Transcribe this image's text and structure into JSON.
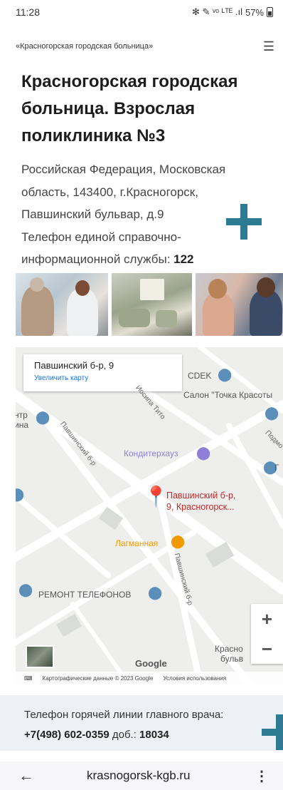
{
  "status_bar": {
    "time": "11:28",
    "icons": "✻ ✎ ᵛᵒ ᴸᵀᴱ .ıl",
    "battery": "57%"
  },
  "header": {
    "breadcrumb": "«Красногорская городская больница»",
    "menu_icon": "hamburger-icon"
  },
  "page": {
    "title": "Красногорская городская больница. Взрослая поликлиника №3",
    "address_lines": [
      "Российская Федерация, Московская",
      "область, 143400, г.Красногорск,",
      "Павшинский бульвар, д.9",
      "Телефон единой справочно-"
    ],
    "phone_label": "информационной службы: ",
    "phone_value": "122"
  },
  "photos": [
    "photo-1",
    "photo-2",
    "photo-3"
  ],
  "map": {
    "info_title": "Павшинский б-р, 9",
    "info_link": "Увеличить карту",
    "marker_label_1": "Павшинский б-р,",
    "marker_label_2": "9, Красногорск...",
    "pois": {
      "cdek": "CDEK",
      "salon": "Салон \"Точка Красоты",
      "centr": "нтр",
      "centr2": "ина",
      "konditer": "Кондитерхауз",
      "lagmannaya": "Лагманная",
      "remont": "РЕМОНТ ТЕЛЕФОНОВ",
      "krasno": "Красно",
      "buly": "бульв",
      "podmo": "Подмо",
      "g": "Г"
    },
    "streets": {
      "tito": "Иосипа Тито",
      "pavsh1": "Павшинский б-р",
      "pavsh2": "Павшинский б-р"
    },
    "zoom_in": "+",
    "zoom_out": "−",
    "google_logo": "Google",
    "attribution": "Картографические данные © 2023 Google",
    "terms": "Условия использования"
  },
  "hotline": {
    "label": "Телефон горячей линии главного врача:",
    "phone": "+7(498) 602-0359",
    "ext_label": " доб.: ",
    "ext": "18034"
  },
  "browser": {
    "back": "←",
    "url": "krasnogorsk-kgb.ru",
    "menu": "⋮"
  },
  "colors": {
    "accent": "#2d7a93",
    "link": "#1a73e8",
    "marker": "#e53935",
    "poi_blue": "#5b8fb9",
    "poi_orange": "#f29900",
    "poi_purple": "#8f7fd6"
  }
}
